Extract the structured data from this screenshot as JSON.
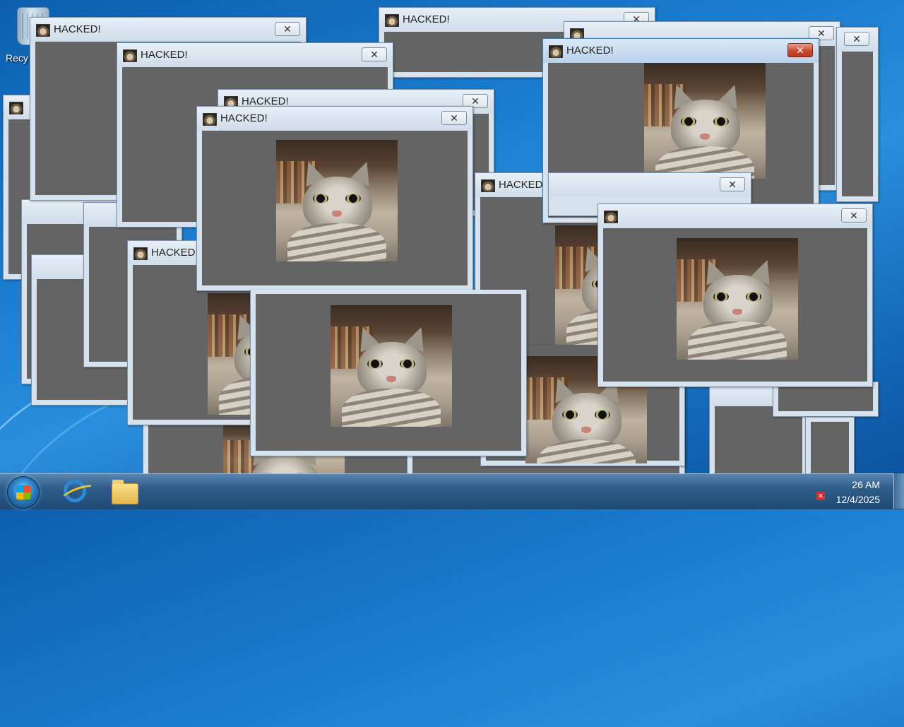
{
  "desktop": {
    "recycle_bin_label": "Recy"
  },
  "popup": {
    "title": "HACKED!",
    "close_glyph": "✕",
    "cat_image": "cat-photo",
    "body_color": "#646464"
  },
  "taskbar": {
    "start_icon": "windows-start-orb",
    "pinned": [
      "internet-explorer-icon",
      "file-explorer-icon"
    ],
    "time": "26 AM",
    "date": "12/4/2025"
  }
}
